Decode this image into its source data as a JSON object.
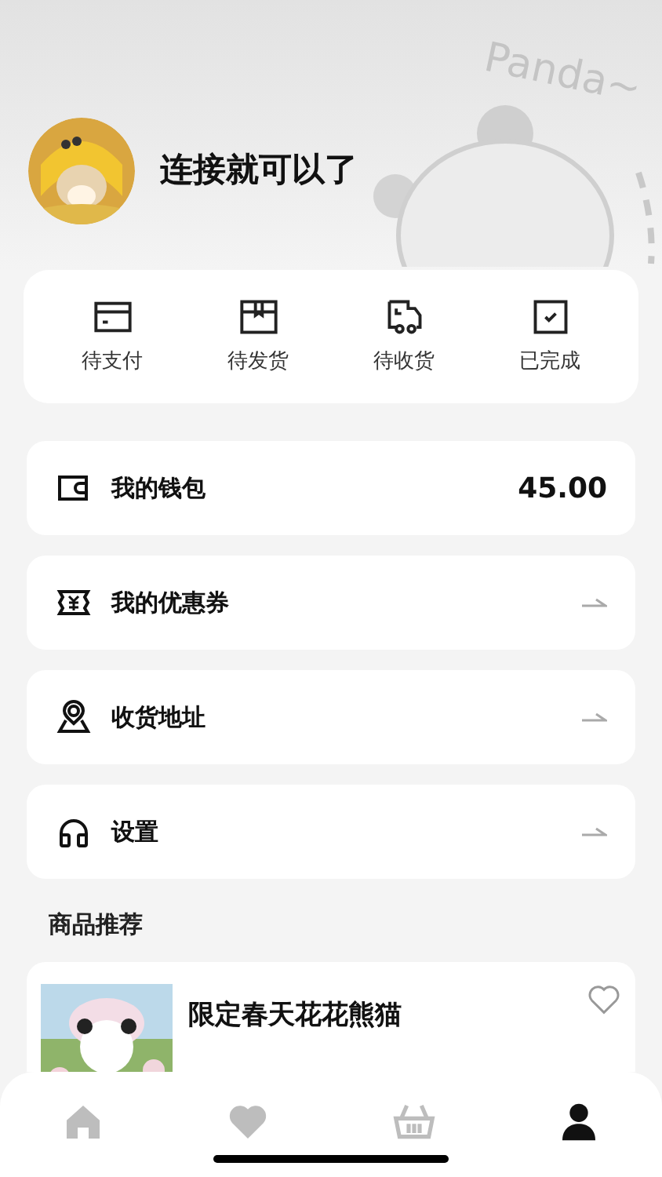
{
  "header": {
    "decoration_text": "Panda~",
    "username": "连接就可以了"
  },
  "orders": [
    {
      "label": "待支付"
    },
    {
      "label": "待发货"
    },
    {
      "label": "待收货"
    },
    {
      "label": "已完成"
    }
  ],
  "menu": [
    {
      "label": "我的钱包",
      "kind": "value",
      "value": "45.00"
    },
    {
      "label": "我的优惠券",
      "kind": "arrow"
    },
    {
      "label": "收货地址",
      "kind": "arrow"
    },
    {
      "label": "设置",
      "kind": "arrow"
    }
  ],
  "recommend": {
    "title": "商品推荐",
    "products": [
      {
        "name": "限定春天花花熊猫",
        "favorite": false
      }
    ]
  },
  "tab_bar": [
    {
      "selected": false
    },
    {
      "selected": false
    },
    {
      "selected": false
    },
    {
      "selected": true
    }
  ]
}
